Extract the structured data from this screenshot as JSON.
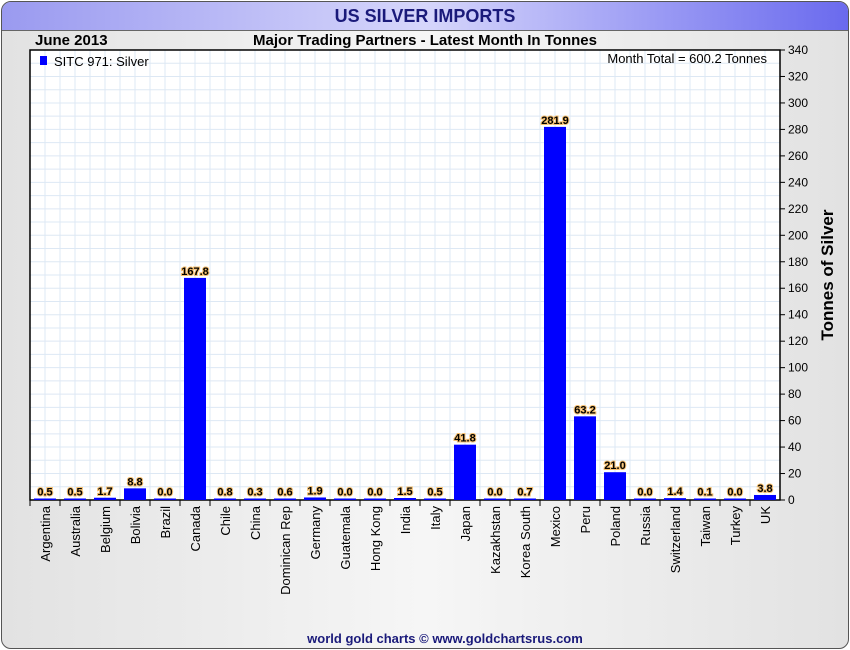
{
  "window_title": "US SILVER IMPORTS",
  "footer": "world gold charts © www.goldchartsrus.com",
  "chart_data": {
    "type": "bar",
    "title": "Major Trading Partners - Latest Month In Tonnes",
    "period": "June 2013",
    "annotation": "Month Total = 600.2 Tonnes",
    "legend": [
      {
        "name": "SITC 971: Silver",
        "color": "#0000ff"
      }
    ],
    "legend_position": "top-left",
    "ylabel": "Tonnes of Silver",
    "ylim": [
      0,
      340
    ],
    "yticks": [
      0,
      20,
      40,
      60,
      80,
      100,
      120,
      140,
      160,
      180,
      200,
      220,
      240,
      260,
      280,
      300,
      320,
      340
    ],
    "grid": true,
    "categories": [
      "Argentina",
      "Australia",
      "Belgium",
      "Bolivia",
      "Brazil",
      "Canada",
      "Chile",
      "China",
      "Dominican Rep",
      "Germany",
      "Guatemala",
      "Hong Kong",
      "India",
      "Italy",
      "Japan",
      "Kazakhstan",
      "Korea South",
      "Mexico",
      "Peru",
      "Poland",
      "Russia",
      "Switzerland",
      "Taiwan",
      "Turkey",
      "UK"
    ],
    "values": [
      0.5,
      0.5,
      1.7,
      8.8,
      0.0,
      167.8,
      0.8,
      0.3,
      0.6,
      1.9,
      0.0,
      0.0,
      1.5,
      0.5,
      41.8,
      0.0,
      0.7,
      281.9,
      63.2,
      21.0,
      0.0,
      1.4,
      0.1,
      0.0,
      3.8
    ],
    "bar_color": "#0000ff"
  }
}
